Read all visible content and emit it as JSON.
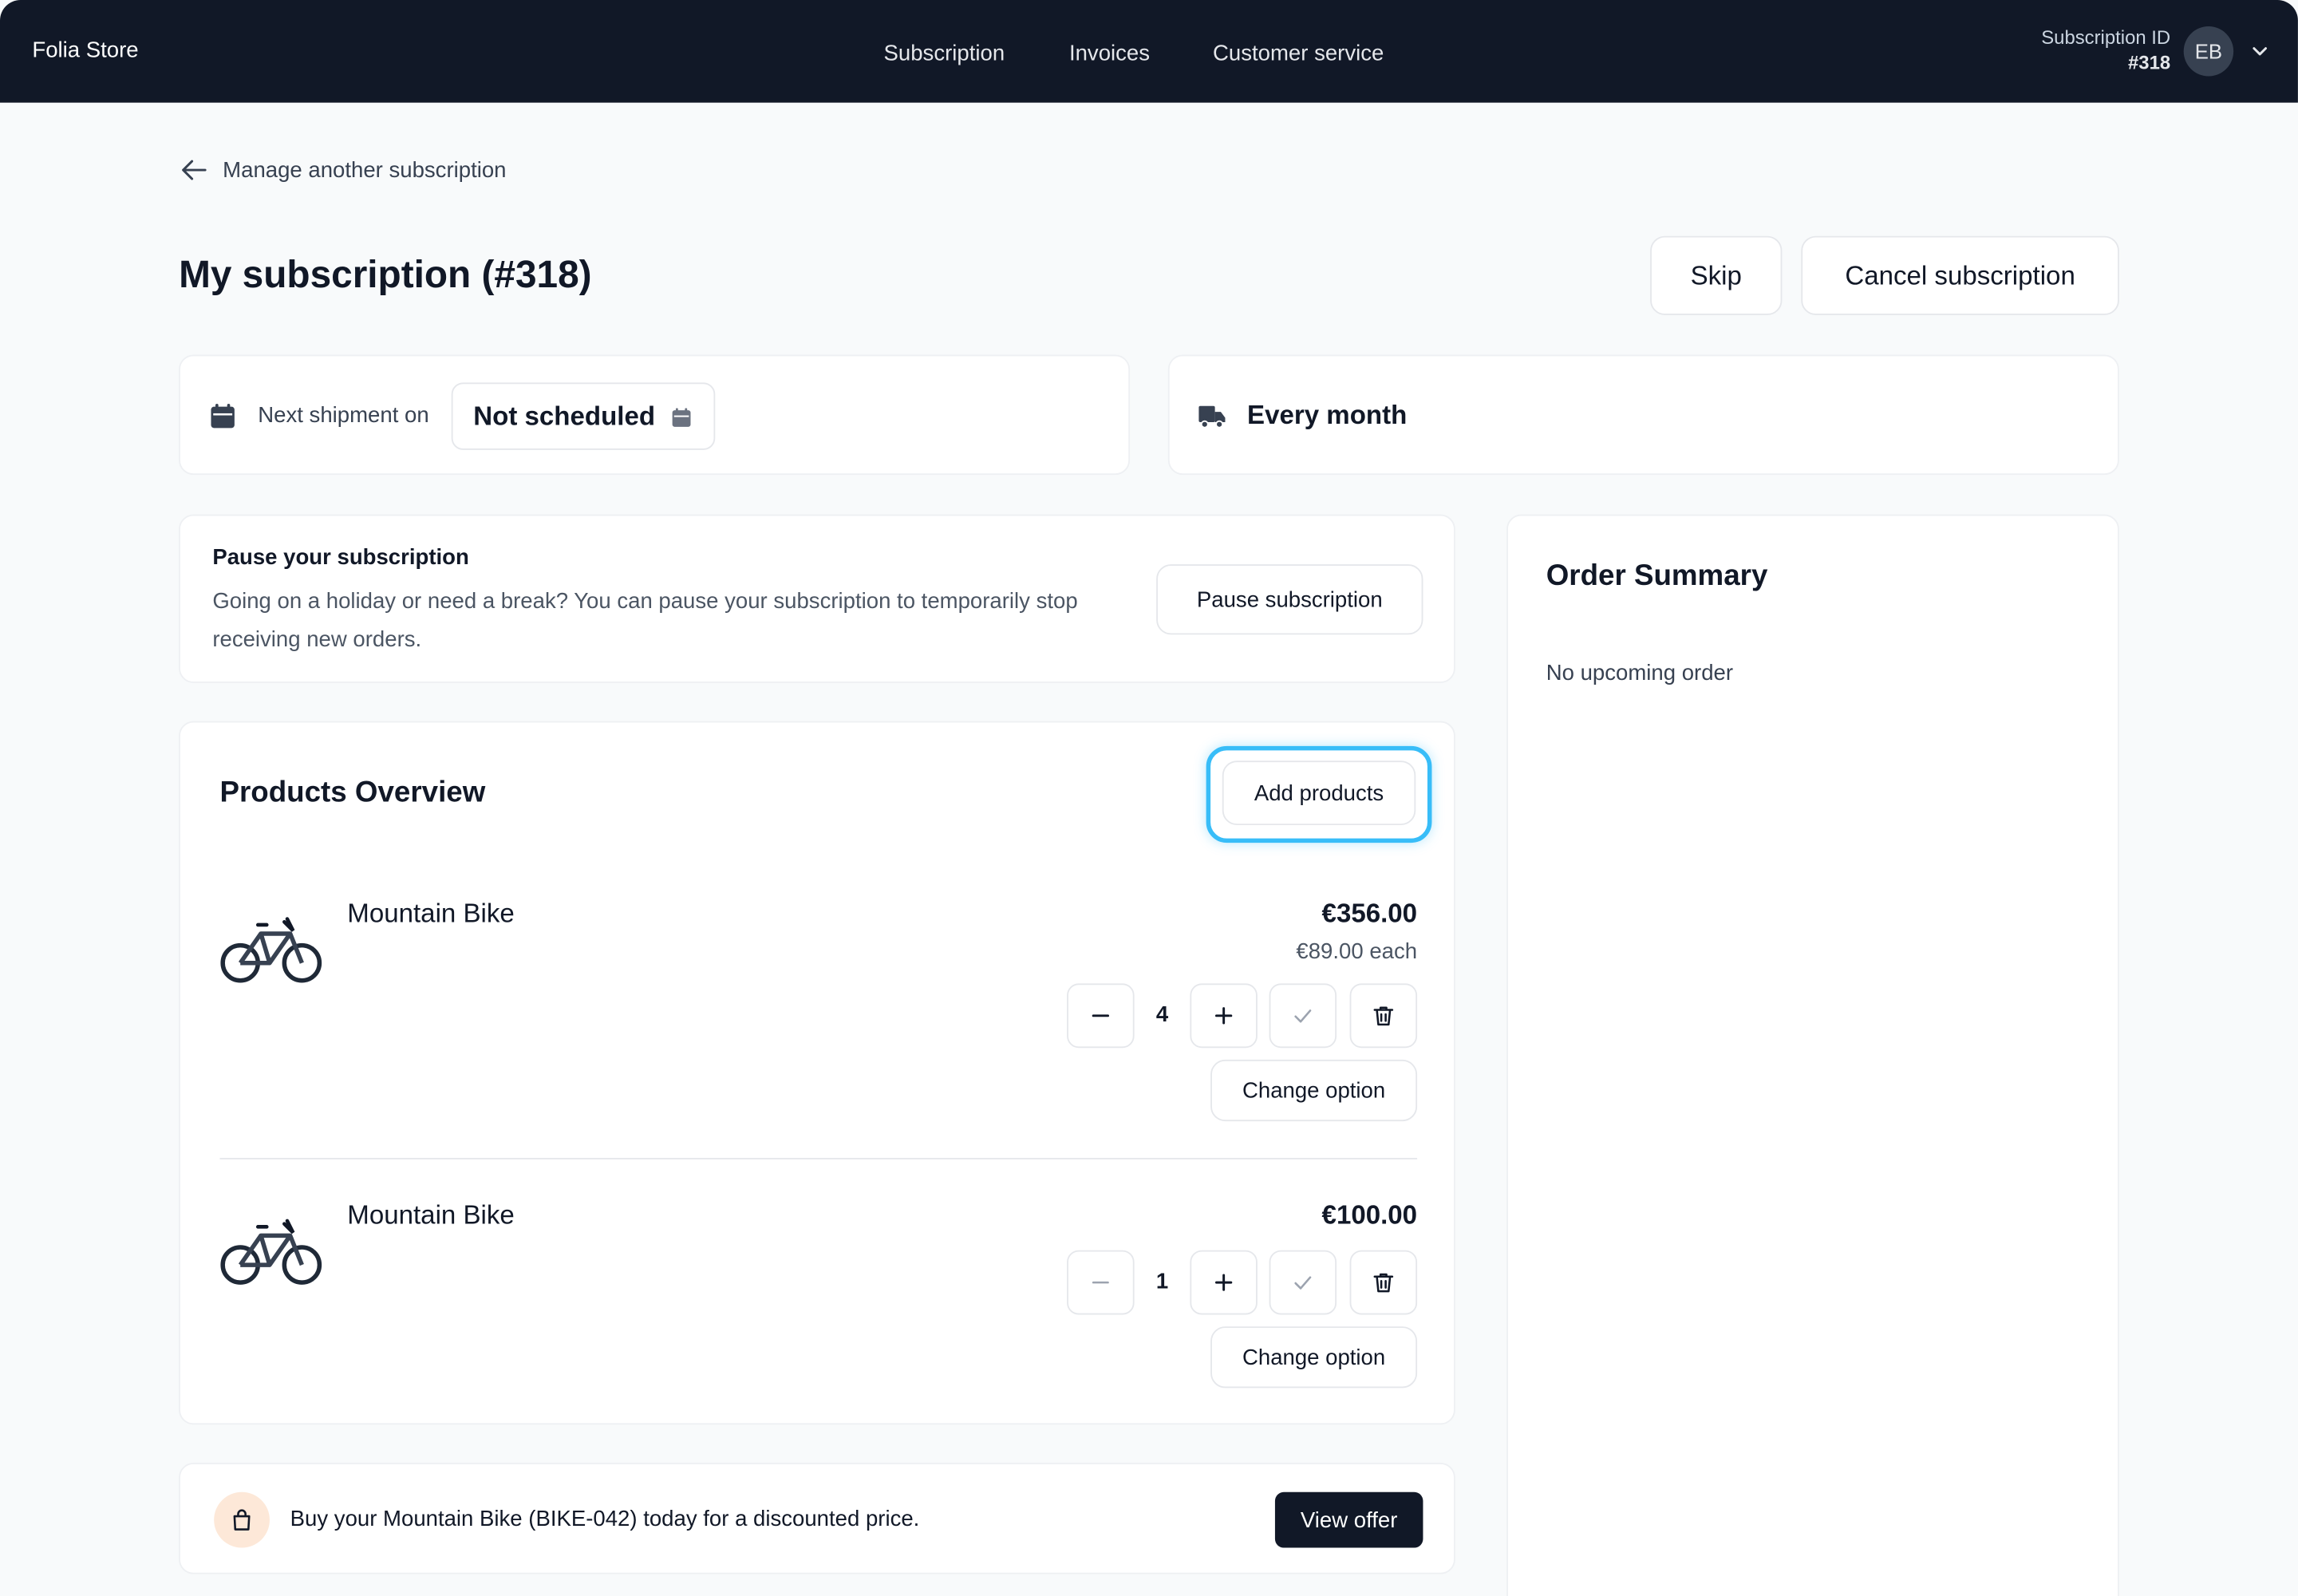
{
  "header": {
    "brand": "Folia Store",
    "nav": [
      "Subscription",
      "Invoices",
      "Customer service"
    ],
    "subscription_id_label": "Subscription ID",
    "subscription_id_value": "#318",
    "avatar_initials": "EB"
  },
  "back_link": "Manage another subscription",
  "page_title": "My subscription (#318)",
  "actions": {
    "skip": "Skip",
    "cancel": "Cancel subscription"
  },
  "shipment": {
    "label": "Next shipment on",
    "value": "Not scheduled"
  },
  "frequency": {
    "value": "Every month"
  },
  "pause": {
    "title": "Pause your subscription",
    "description": "Going on a holiday or need a break? You can pause your subscription to temporarily stop receiving new orders.",
    "button": "Pause subscription"
  },
  "products": {
    "title": "Products Overview",
    "add_button": "Add products",
    "items": [
      {
        "name": "Mountain Bike",
        "total": "€356.00",
        "each": "€89.00 each",
        "quantity": "4",
        "change_option": "Change option"
      },
      {
        "name": "Mountain Bike",
        "total": "€100.00",
        "each": "",
        "quantity": "1",
        "change_option": "Change option"
      }
    ]
  },
  "offer": {
    "text": "Buy your Mountain Bike (BIKE-042) today for a discounted price.",
    "button": "View offer"
  },
  "summary": {
    "title": "Order Summary",
    "empty": "No upcoming order"
  },
  "icons": {
    "back": "arrow-left-icon",
    "calendar": "calendar-icon",
    "truck": "truck-icon",
    "chevron": "chevron-down-icon",
    "minus": "minus-icon",
    "plus": "plus-icon",
    "check": "check-icon",
    "trash": "trash-icon",
    "bag": "shopping-bag-icon"
  },
  "colors": {
    "header_bg": "#111827",
    "focus_ring": "#38bdf8",
    "offer_icon_bg": "#fde8d8"
  }
}
